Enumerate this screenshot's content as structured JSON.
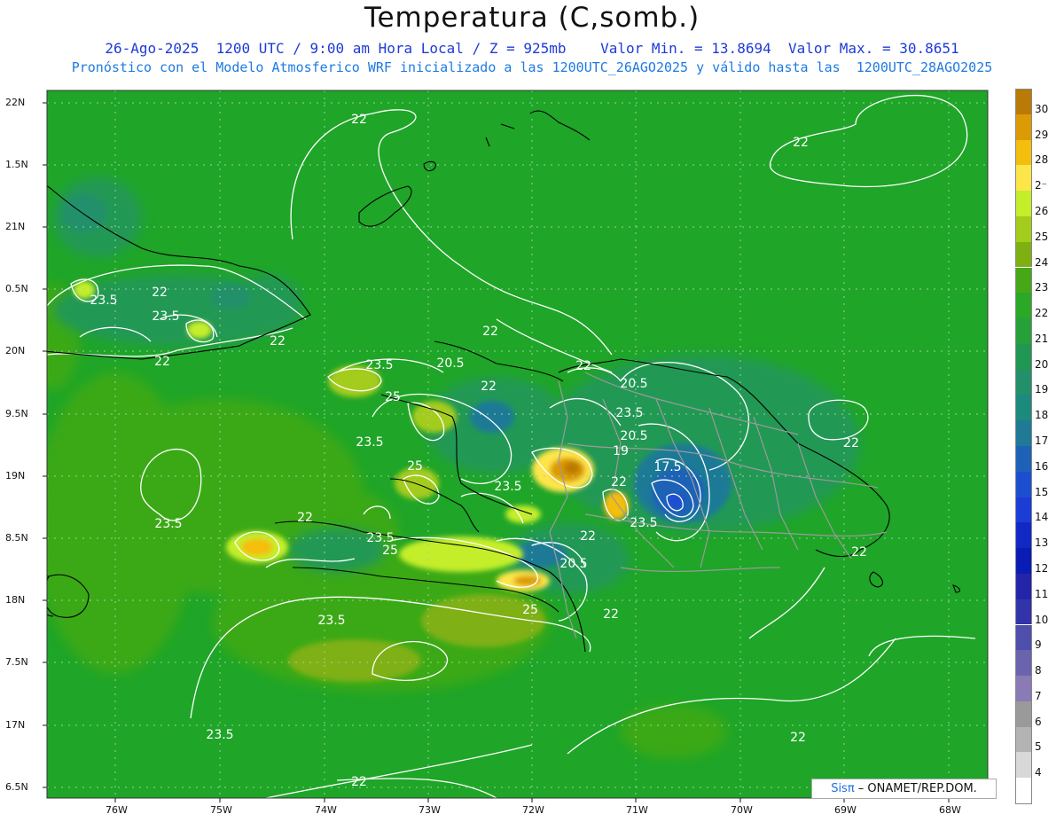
{
  "header": {
    "title": "Temperatura (C,somb.)",
    "line1": "26-Ago-2025  1200 UTC / 9:00 am Hora Local / Z = 925mb    Valor Min. = 13.8694  Valor Max. = 30.8651",
    "line2": "Pronóstico con el Modelo Atmosferico WRF inicializado a las 1200UTC_26AGO2025 y válido hasta las  1200UTC_28AGO2025"
  },
  "axes": {
    "lat_labels": [
      "22N",
      "1.5N",
      "21N",
      "0.5N",
      "20N",
      "9.5N",
      "19N",
      "8.5N",
      "18N",
      "7.5N",
      "17N",
      "6.5N"
    ],
    "lon_labels": [
      "76W",
      "75W",
      "74W",
      "73W",
      "72W",
      "71W",
      "70W",
      "69W",
      "68W"
    ]
  },
  "colorbar": {
    "labels": [
      "30",
      "29",
      "28",
      "2⁻",
      "26",
      "25",
      "24",
      "23",
      "22",
      "21",
      "20",
      "19",
      "18",
      "17",
      "16",
      "15",
      "14",
      "13",
      "12",
      "11",
      "10",
      "9",
      "8",
      "7",
      "6",
      "5",
      "4"
    ],
    "colors": [
      "#b97a06",
      "#dc9a05",
      "#f4be0c",
      "#fde64a",
      "#c4ee2a",
      "#a4cc1c",
      "#7fb012",
      "#46a817",
      "#2aa826",
      "#26a13a",
      "#209854",
      "#23906a",
      "#1d8a7e",
      "#1f7a96",
      "#1d62b6",
      "#1b4fd0",
      "#1b3cd5",
      "#1029c4",
      "#0a1cb4",
      "#2424aa",
      "#3434aa",
      "#4e4ead",
      "#6a63ad",
      "#8a7ab5",
      "#9a9a9a",
      "#b3b3b3",
      "#d8d8d8"
    ],
    "bottom_color": "#ffffff"
  },
  "contour_labels": [
    "22",
    "22",
    "23.5",
    "22",
    "23.5",
    "22",
    "22",
    "23.5",
    "20.5",
    "22",
    "22",
    "20.5",
    "23.5",
    "25",
    "23.5",
    "20.5",
    "22",
    "19",
    "17.5",
    "25",
    "23.5",
    "22",
    "23.5",
    "22",
    "23.5",
    "25",
    "23.5",
    "22",
    "20.5",
    "22",
    "25",
    "22",
    "23.5",
    "23.5",
    "22",
    "22",
    "22"
  ],
  "credit": {
    "brand": "Sisπ",
    "rest": " –  ONAMET/REP.DOM."
  }
}
